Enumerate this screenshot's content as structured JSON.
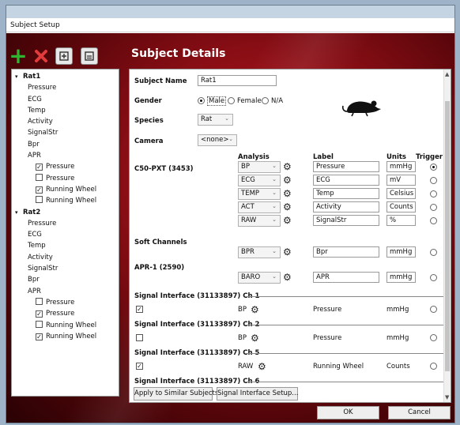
{
  "window": {
    "title": "Subject Setup"
  },
  "toolbar": {
    "add_icon": "plus-icon",
    "delete_icon": "x-icon",
    "duplicate_icon": "duplicate-icon",
    "import_icon": "import-icon"
  },
  "heading": "Subject Details",
  "tree": {
    "subjects": [
      {
        "name": "Rat1",
        "items": [
          "Pressure",
          "ECG",
          "Temp",
          "Activity",
          "SignalStr",
          "Bpr",
          "APR"
        ],
        "apr_children": [
          {
            "label": "Pressure",
            "checked": true
          },
          {
            "label": "Pressure",
            "checked": false
          },
          {
            "label": "Running Wheel",
            "checked": true
          },
          {
            "label": "Running Wheel",
            "checked": false
          }
        ]
      },
      {
        "name": "Rat2",
        "items": [
          "Pressure",
          "ECG",
          "Temp",
          "Activity",
          "SignalStr",
          "Bpr",
          "APR"
        ],
        "apr_children": [
          {
            "label": "Pressure",
            "checked": false
          },
          {
            "label": "Pressure",
            "checked": true
          },
          {
            "label": "Running Wheel",
            "checked": false
          },
          {
            "label": "Running Wheel",
            "checked": true
          }
        ]
      }
    ]
  },
  "form": {
    "subject_name_label": "Subject Name",
    "subject_name_value": "Rat1",
    "gender_label": "Gender",
    "gender_options": [
      "Male",
      "Female",
      "N/A"
    ],
    "gender_selected": "Male",
    "species_label": "Species",
    "species_value": "Rat",
    "camera_label": "Camera",
    "camera_value": "<none>",
    "rat_icon": "rat-icon"
  },
  "table": {
    "headers": {
      "analysis": "Analysis",
      "label": "Label",
      "units": "Units",
      "trigger": "Trigger"
    },
    "device_c50": "C50-PXT (3453)",
    "c50_rows": [
      {
        "analysis": "BP",
        "label": "Pressure",
        "units": "mmHg",
        "trigger": true
      },
      {
        "analysis": "ECG",
        "label": "ECG",
        "units": "mV",
        "trigger": false
      },
      {
        "analysis": "TEMP",
        "label": "Temp",
        "units": "Celsius",
        "trigger": false
      },
      {
        "analysis": "ACT",
        "label": "Activity",
        "units": "Counts",
        "trigger": false
      },
      {
        "analysis": "RAW",
        "label": "SignalStr",
        "units": "%",
        "trigger": false
      }
    ],
    "soft_channels": "Soft Channels",
    "soft_rows": [
      {
        "analysis": "BPR",
        "label": "Bpr",
        "units": "mmHg",
        "trigger": false
      }
    ],
    "device_apr": "APR-1 (2590)",
    "apr_rows": [
      {
        "analysis": "BARO",
        "label": "APR",
        "units": "mmHg",
        "trigger": false
      }
    ],
    "signal_interfaces": [
      {
        "title": "Signal Interface (31133897) Ch 1",
        "checked": true,
        "analysis": "BP",
        "label": "Pressure",
        "units": "mmHg",
        "trigger": false
      },
      {
        "title": "Signal Interface (31133897) Ch 2",
        "checked": false,
        "analysis": "BP",
        "label": "Pressure",
        "units": "mmHg",
        "trigger": false
      },
      {
        "title": "Signal Interface (31133897) Ch 5",
        "checked": true,
        "analysis": "RAW",
        "label": "Running Wheel",
        "units": "Counts",
        "trigger": false
      },
      {
        "title": "Signal Interface (31133897) Ch 6"
      }
    ]
  },
  "buttons": {
    "apply_similar": "Apply to Similar Subjects",
    "signal_setup": "Signal Interface Setup...",
    "ok": "OK",
    "cancel": "Cancel"
  }
}
